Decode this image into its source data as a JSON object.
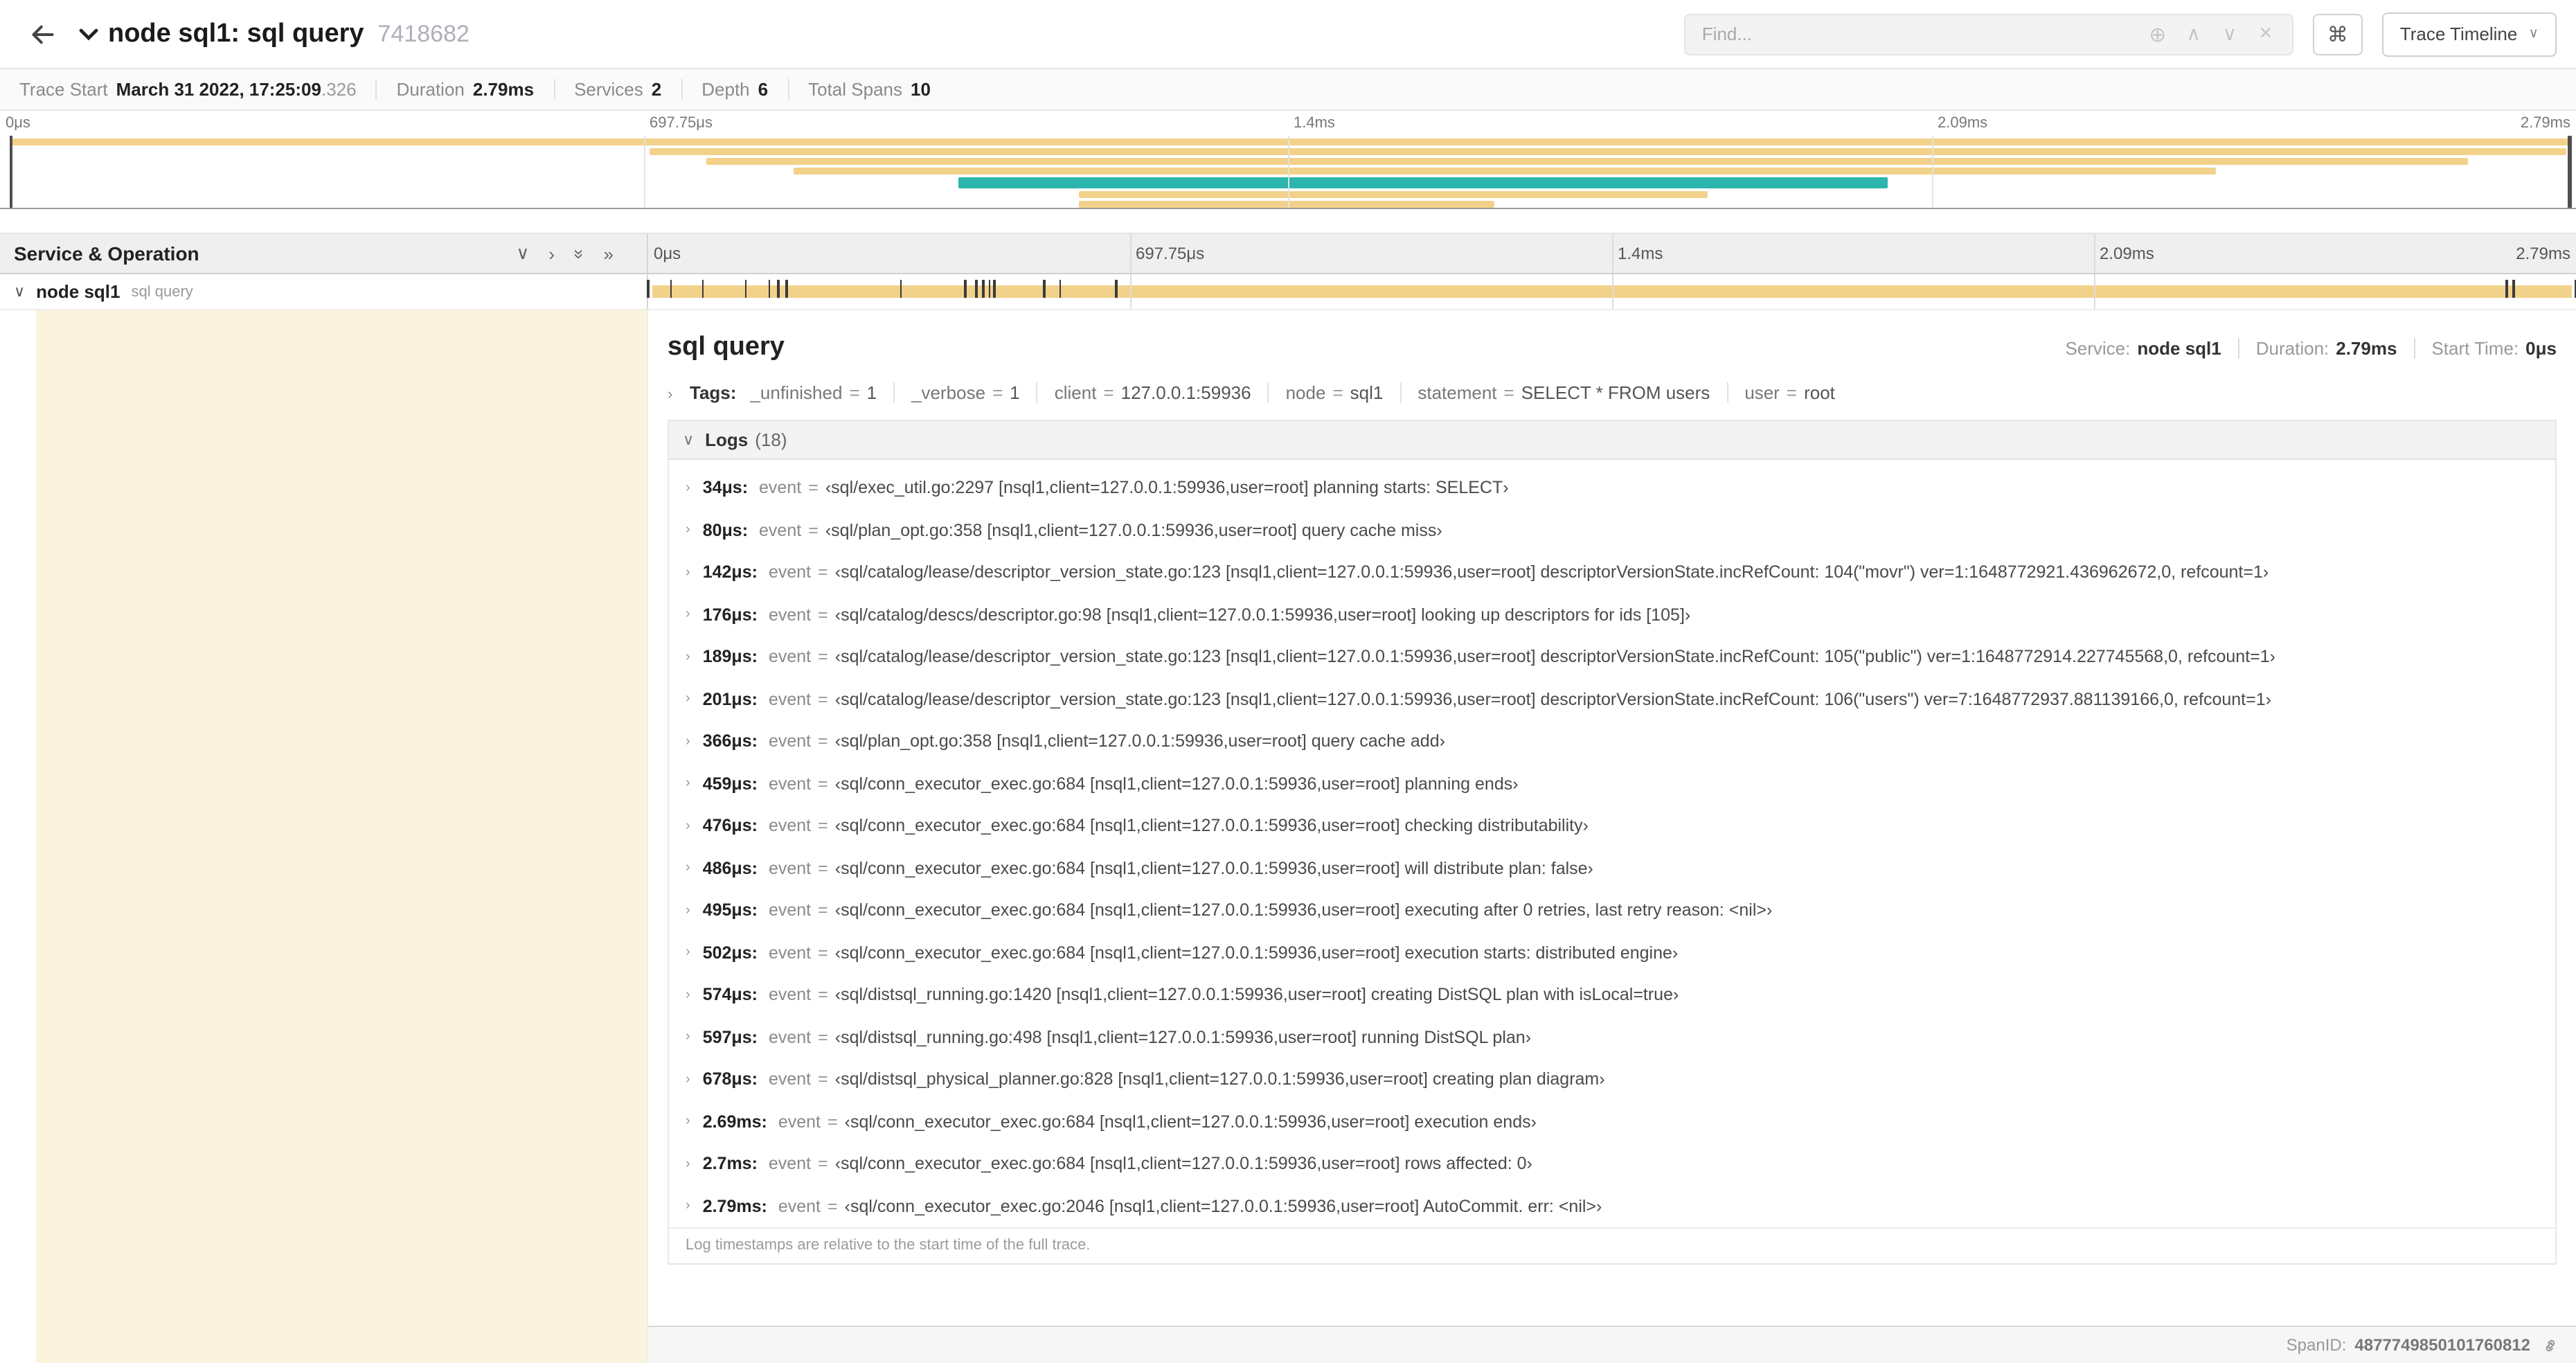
{
  "colors": {
    "tan": "#F2D28A",
    "teal": "#2BB5AD",
    "cream": "#FBF3DD"
  },
  "header": {
    "title": "node sql1: sql query",
    "trace_id": "7418682",
    "find_placeholder": "Find...",
    "trace_timeline_label": "Trace Timeline",
    "icons": {
      "circle_plus": "⊕",
      "up": "∧",
      "down": "∨",
      "clear": "×",
      "command": "⌘",
      "dropdown_chevron": "∨"
    }
  },
  "summary": {
    "items": [
      {
        "label": "Trace Start",
        "value": "March 31 2022, 17:25:09",
        "suffix": ".326"
      },
      {
        "label": "Duration",
        "value": "2.79ms",
        "suffix": ""
      },
      {
        "label": "Services",
        "value": "2",
        "suffix": ""
      },
      {
        "label": "Depth",
        "value": "6",
        "suffix": ""
      },
      {
        "label": "Total Spans",
        "value": "10",
        "suffix": ""
      }
    ]
  },
  "time_axis": {
    "labels": [
      {
        "text": "0μs",
        "pos": 0
      },
      {
        "text": "697.75μs",
        "pos": 25
      },
      {
        "text": "1.4ms",
        "pos": 50
      },
      {
        "text": "2.09ms",
        "pos": 75
      },
      {
        "text": "2.79ms",
        "pos": 100
      }
    ]
  },
  "minimap": {
    "spans": [
      {
        "row": 0,
        "start": 0.4,
        "end": 99.8,
        "color": "tan"
      },
      {
        "row": 1,
        "start": 25.2,
        "end": 99.6,
        "color": "tan"
      },
      {
        "row": 2,
        "start": 27.4,
        "end": 95.8,
        "color": "tan"
      },
      {
        "row": 3,
        "start": 30.8,
        "end": 86.0,
        "color": "tan"
      },
      {
        "row": 4,
        "start": 37.2,
        "end": 73.3,
        "color": "teal",
        "h": 8
      },
      {
        "row": 5,
        "start": 41.9,
        "end": 66.3,
        "color": "tan"
      },
      {
        "row": 6,
        "start": 41.9,
        "end": 58.0,
        "color": "tan"
      }
    ]
  },
  "ruler": {
    "title": "Service & Operation",
    "icons": [
      "∨",
      "›",
      "»",
      "»"
    ]
  },
  "timeline": {
    "duration_us": 2790,
    "span_row": {
      "chevron": "∨",
      "service": "node sql1",
      "operation": "sql query"
    },
    "event_ticks_us": [
      34,
      80,
      142,
      176,
      189,
      201,
      366,
      459,
      476,
      486,
      495,
      502,
      574,
      597,
      678,
      2690,
      2700,
      2790
    ]
  },
  "detail": {
    "title": "sql query",
    "eq_sign": "=",
    "meta": [
      {
        "label": "Service:",
        "value": "node sql1"
      },
      {
        "label": "Duration:",
        "value": "2.79ms"
      },
      {
        "label": "Start Time:",
        "value": "0μs"
      }
    ],
    "tags_chevron": "›",
    "tags_label": "Tags:",
    "tags": [
      {
        "key": "_unfinished",
        "value": "1"
      },
      {
        "key": "_verbose",
        "value": "1"
      },
      {
        "key": "client",
        "value": "127.0.0.1:59936"
      },
      {
        "key": "node",
        "value": "sql1"
      },
      {
        "key": "statement",
        "value": "SELECT * FROM users"
      },
      {
        "key": "user",
        "value": "root"
      }
    ],
    "logs_chevron": "∨",
    "logs_label": "Logs",
    "logs_count": "(18)",
    "log_row_chevron": "›",
    "logs": [
      {
        "t": "34μs:",
        "k": "event",
        "v": "‹sql/exec_util.go:2297 [nsql1,client=127.0.0.1:59936,user=root] planning starts: SELECT›"
      },
      {
        "t": "80μs:",
        "k": "event",
        "v": "‹sql/plan_opt.go:358 [nsql1,client=127.0.0.1:59936,user=root] query cache miss›"
      },
      {
        "t": "142μs:",
        "k": "event",
        "v": "‹sql/catalog/lease/descriptor_version_state.go:123 [nsql1,client=127.0.0.1:59936,user=root] descriptorVersionState.incRefCount: 104(\"movr\") ver=1:1648772921.436962672,0, refcount=1›"
      },
      {
        "t": "176μs:",
        "k": "event",
        "v": "‹sql/catalog/descs/descriptor.go:98 [nsql1,client=127.0.0.1:59936,user=root] looking up descriptors for ids [105]›"
      },
      {
        "t": "189μs:",
        "k": "event",
        "v": "‹sql/catalog/lease/descriptor_version_state.go:123 [nsql1,client=127.0.0.1:59936,user=root] descriptorVersionState.incRefCount: 105(\"public\") ver=1:1648772914.227745568,0, refcount=1›"
      },
      {
        "t": "201μs:",
        "k": "event",
        "v": "‹sql/catalog/lease/descriptor_version_state.go:123 [nsql1,client=127.0.0.1:59936,user=root] descriptorVersionState.incRefCount: 106(\"users\") ver=7:1648772937.881139166,0, refcount=1›"
      },
      {
        "t": "366μs:",
        "k": "event",
        "v": "‹sql/plan_opt.go:358 [nsql1,client=127.0.0.1:59936,user=root] query cache add›"
      },
      {
        "t": "459μs:",
        "k": "event",
        "v": "‹sql/conn_executor_exec.go:684 [nsql1,client=127.0.0.1:59936,user=root] planning ends›"
      },
      {
        "t": "476μs:",
        "k": "event",
        "v": "‹sql/conn_executor_exec.go:684 [nsql1,client=127.0.0.1:59936,user=root] checking distributability›"
      },
      {
        "t": "486μs:",
        "k": "event",
        "v": "‹sql/conn_executor_exec.go:684 [nsql1,client=127.0.0.1:59936,user=root] will distribute plan: false›"
      },
      {
        "t": "495μs:",
        "k": "event",
        "v": "‹sql/conn_executor_exec.go:684 [nsql1,client=127.0.0.1:59936,user=root] executing after 0 retries, last retry reason: <nil>›"
      },
      {
        "t": "502μs:",
        "k": "event",
        "v": "‹sql/conn_executor_exec.go:684 [nsql1,client=127.0.0.1:59936,user=root] execution starts: distributed engine›"
      },
      {
        "t": "574μs:",
        "k": "event",
        "v": "‹sql/distsql_running.go:1420 [nsql1,client=127.0.0.1:59936,user=root] creating DistSQL plan with isLocal=true›"
      },
      {
        "t": "597μs:",
        "k": "event",
        "v": "‹sql/distsql_running.go:498 [nsql1,client=127.0.0.1:59936,user=root] running DistSQL plan›"
      },
      {
        "t": "678μs:",
        "k": "event",
        "v": "‹sql/distsql_physical_planner.go:828 [nsql1,client=127.0.0.1:59936,user=root] creating plan diagram›"
      },
      {
        "t": "2.69ms:",
        "k": "event",
        "v": "‹sql/conn_executor_exec.go:684 [nsql1,client=127.0.0.1:59936,user=root] execution ends›"
      },
      {
        "t": "2.7ms:",
        "k": "event",
        "v": "‹sql/conn_executor_exec.go:684 [nsql1,client=127.0.0.1:59936,user=root] rows affected: 0›"
      },
      {
        "t": "2.79ms:",
        "k": "event",
        "v": "‹sql/conn_executor_exec.go:2046 [nsql1,client=127.0.0.1:59936,user=root] AutoCommit. err: <nil>›"
      }
    ],
    "footer_note": "Log timestamps are relative to the start time of the full trace.",
    "span_id_label": "SpanID:",
    "span_id": "4877749850101760812"
  }
}
